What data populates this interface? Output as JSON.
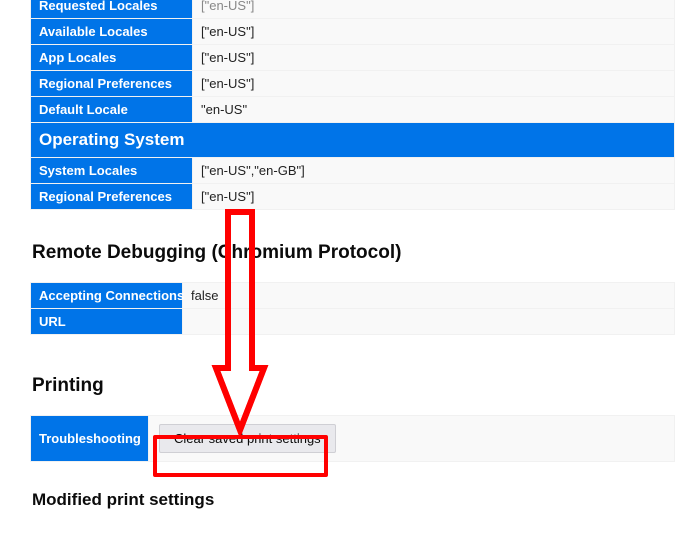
{
  "intl": {
    "rows": [
      {
        "label": "Requested Locales",
        "value": "[\"en-US\"]"
      },
      {
        "label": "Available Locales",
        "value": "[\"en-US\"]"
      },
      {
        "label": "App Locales",
        "value": "[\"en-US\"]"
      },
      {
        "label": "Regional Preferences",
        "value": "[\"en-US\"]"
      },
      {
        "label": "Default Locale",
        "value": "\"en-US\""
      }
    ],
    "os_header": "Operating System",
    "os_rows": [
      {
        "label": "System Locales",
        "value": "[\"en-US\",\"en-GB\"]"
      },
      {
        "label": "Regional Preferences",
        "value": "[\"en-US\"]"
      }
    ]
  },
  "remote_debugging": {
    "title": "Remote Debugging (Chromium Protocol)",
    "rows": [
      {
        "label": "Accepting Connections",
        "value": "false"
      },
      {
        "label": "URL",
        "value": ""
      }
    ]
  },
  "printing": {
    "title": "Printing",
    "troubleshooting_label": "Troubleshooting",
    "clear_button": "Clear saved print settings",
    "modified_title": "Modified print settings"
  },
  "annotation": {
    "arrow_color": "#ff0000"
  }
}
